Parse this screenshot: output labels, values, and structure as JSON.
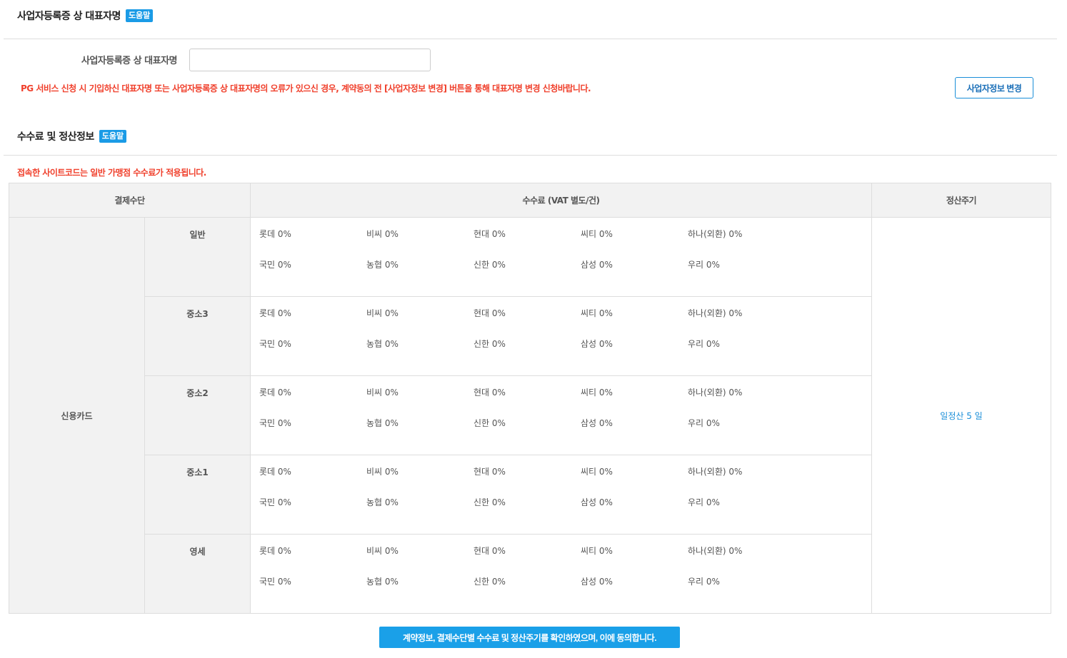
{
  "rep_section": {
    "title": "사업자등록증 상 대표자명",
    "help": "도움말",
    "field_label": "사업자등록증 상 대표자명",
    "field_value": "",
    "warning": "PG 서비스 신청 시 기입하신 대표자명 또는 사업자등록증 상 대표자명의 오류가 있으신 경우, 계약동의 전 [사업자정보 변경] 버튼을 통해 대표자명 변경 신청바랍니다.",
    "change_button": "사업자정보 변경"
  },
  "fee_section": {
    "title": "수수료 및 정산정보",
    "help": "도움말",
    "notice": "접속한 사이트코드는 일반 가맹점 수수료가 적용됩니다.",
    "headers": {
      "method": "결제수단",
      "fee": "수수료 (VAT 별도/건)",
      "cycle": "정산주기"
    },
    "method": "신용카드",
    "cycle_value": "일정산 5 일",
    "tiers": [
      {
        "name": "일반",
        "rows": [
          [
            "롯데 0%",
            "비씨 0%",
            "현대 0%",
            "씨티 0%",
            "하나(외환) 0%"
          ],
          [
            "국민 0%",
            "농협 0%",
            "신한 0%",
            "삼성 0%",
            "우리 0%"
          ]
        ]
      },
      {
        "name": "중소3",
        "rows": [
          [
            "롯데 0%",
            "비씨 0%",
            "현대 0%",
            "씨티 0%",
            "하나(외환) 0%"
          ],
          [
            "국민 0%",
            "농협 0%",
            "신한 0%",
            "삼성 0%",
            "우리 0%"
          ]
        ]
      },
      {
        "name": "중소2",
        "rows": [
          [
            "롯데 0%",
            "비씨 0%",
            "현대 0%",
            "씨티 0%",
            "하나(외환) 0%"
          ],
          [
            "국민 0%",
            "농협 0%",
            "신한 0%",
            "삼성 0%",
            "우리 0%"
          ]
        ]
      },
      {
        "name": "중소1",
        "rows": [
          [
            "롯데 0%",
            "비씨 0%",
            "현대 0%",
            "씨티 0%",
            "하나(외환) 0%"
          ],
          [
            "국민 0%",
            "농협 0%",
            "신한 0%",
            "삼성 0%",
            "우리 0%"
          ]
        ]
      },
      {
        "name": "영세",
        "rows": [
          [
            "롯데 0%",
            "비씨 0%",
            "현대 0%",
            "씨티 0%",
            "하나(외환) 0%"
          ],
          [
            "국민 0%",
            "농협 0%",
            "신한 0%",
            "삼성 0%",
            "우리 0%"
          ]
        ]
      }
    ]
  },
  "agree_button": "계약정보, 결제수단별 수수료 및 정산주기를 확인하였으며, 이에 동의합니다.",
  "colors": {
    "accent": "#1a9be6",
    "warning": "#f0402c",
    "header_bg": "#f2f2f2"
  }
}
